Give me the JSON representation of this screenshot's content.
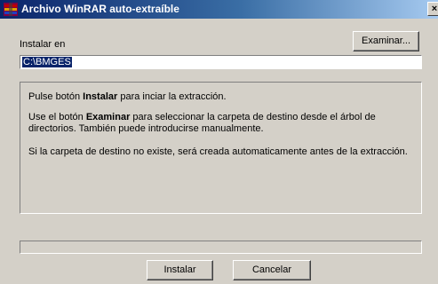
{
  "window": {
    "title": "Archivo WinRAR auto-extraíble",
    "close_glyph": "×"
  },
  "install_label": "Instalar en",
  "browse_button": "Examinar...",
  "path_value": "C:\\BMGES",
  "info": {
    "p1_before": "Pulse botón ",
    "p1_bold": "Instalar",
    "p1_after": " para inciar la extracción.",
    "p2_before": "Use el botón ",
    "p2_bold": "Examinar",
    "p2_after": " para seleccionar la carpeta de destino desde el árbol de directorios. También puede introducirse manualmente.",
    "p3": "Si la carpeta de destino no existe, será creada automaticamente antes de la extracción."
  },
  "buttons": {
    "install": "Instalar",
    "cancel": "Cancelar"
  },
  "progress_value": 0
}
